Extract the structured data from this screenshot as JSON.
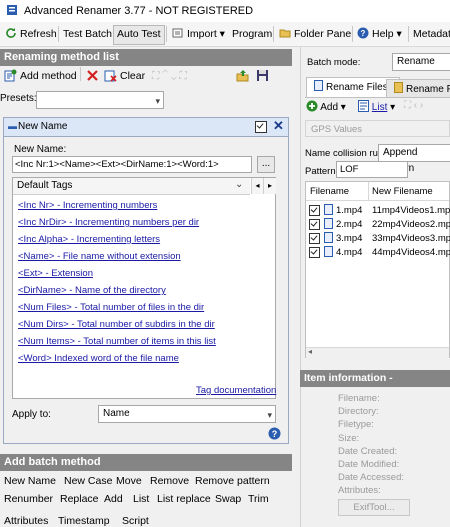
{
  "window": {
    "title": "Advanced Renamer 3.77 - NOT REGISTERED"
  },
  "toolbar": {
    "refresh": "Refresh",
    "test_batch": "Test Batch",
    "auto_test": "Auto Test",
    "import": "Import",
    "program": "Program",
    "folder_panel": "Folder Panel",
    "help": "Help",
    "metadata": "Metadat"
  },
  "left": {
    "method_list_header": "Renaming method list",
    "add_method": "Add method",
    "clear": "Clear",
    "presets_label": "Presets:",
    "presets_value": "",
    "method": {
      "title": "New Name",
      "new_name_label": "New Name:",
      "new_name_value": "<Inc Nr:1><Name><Ext><DirName:1><Word:1>",
      "browse_label": "...",
      "default_tags_label": "Default Tags",
      "tags": [
        "<Inc Nr> - Incrementing numbers",
        "<Inc NrDir> - Incrementing numbers per dir",
        "<Inc Alpha> - Incrementing letters",
        "<Name> - File name without extension",
        "<Ext> - Extension",
        "<DirName> - Name of the directory",
        "<Num Files> - Total number of files in the dir",
        "<Num Dirs> - Total number of subdirs in the dir",
        "<Num Items> - Total number of items in this list",
        "<Word> Indexed word of the file name"
      ],
      "tag_documentation": "Tag documentation",
      "apply_to_label": "Apply to:",
      "apply_to_value": "Name",
      "help_icon_glyph": "?"
    },
    "batch_header": "Add batch method",
    "batch_methods": [
      [
        "New Name",
        "New Case",
        "Move",
        "Remove",
        "Remove pattern"
      ],
      [
        "Renumber",
        "Replace",
        "Add",
        "List",
        "List replace",
        "Swap",
        "Trim"
      ],
      [
        "Attributes",
        "Timestamp",
        "Script"
      ]
    ]
  },
  "right": {
    "batch_mode_label": "Batch mode:",
    "batch_mode_value": "Rename",
    "tab_rename_files": "Rename Files",
    "tab_rename_folders": "Rename Fol",
    "add_label": "Add",
    "list_label": "List",
    "gps_values": "GPS Values",
    "collision_label": "Name collision rule:",
    "collision_value": "Append pattern",
    "pattern_label": "Pattern:",
    "pattern_value": "LOF",
    "columns": [
      "Filename",
      "New Filename"
    ],
    "files": [
      {
        "filename": "1.mp4",
        "new_filename": "11mp4Videos1.mp4"
      },
      {
        "filename": "2.mp4",
        "new_filename": "22mp4Videos2.mp4"
      },
      {
        "filename": "3.mp4",
        "new_filename": "33mp4Videos3.mp4"
      },
      {
        "filename": "4.mp4",
        "new_filename": "44mp4Videos4.mp4"
      }
    ],
    "item_info_header": "Item information -",
    "info_labels": [
      "Filename:",
      "Directory:",
      "Filetype:",
      "Size:",
      "Date Created:",
      "Date Modified:",
      "Date Accessed:",
      "Attributes:"
    ],
    "exiftool": "ExifTool..."
  },
  "colors": {
    "panel_header": "#858585",
    "link": "#1a1aa6",
    "accent_blue": "#2a5db0",
    "delete_red": "#d42020"
  }
}
